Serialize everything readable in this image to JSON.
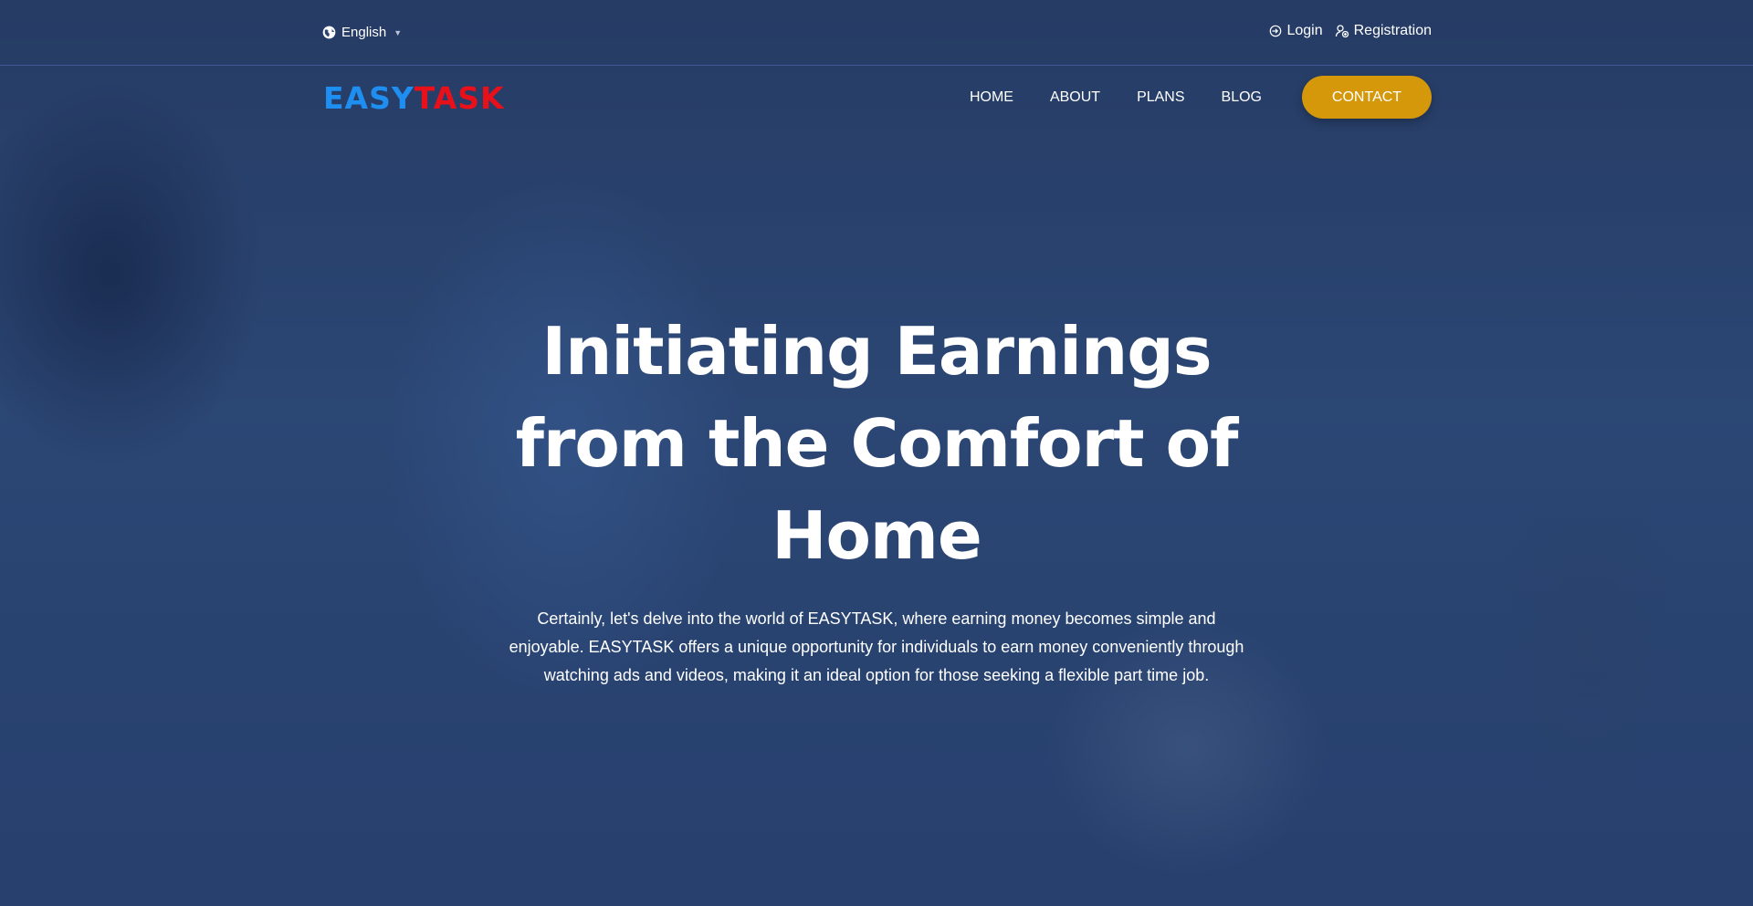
{
  "topbar": {
    "language": "English",
    "login_label": "Login",
    "registration_label": "Registration"
  },
  "brand": {
    "logo_part1": "EASY",
    "logo_part2": "TASK",
    "colors": {
      "easy": "#1e8ef0",
      "task": "#e8101a",
      "accent": "#d4980a"
    }
  },
  "nav": {
    "items": [
      {
        "label": "HOME"
      },
      {
        "label": "ABOUT"
      },
      {
        "label": "PLANS"
      },
      {
        "label": "BLOG"
      }
    ],
    "contact_label": "CONTACT"
  },
  "hero": {
    "headline_lines": [
      "Initiating Earnings",
      "from the Comfort of",
      "Home"
    ],
    "subtext_lines": [
      "Certainly, let's delve into the world of EASYTASK, where earning money becomes simple and",
      "enjoyable. EASYTASK offers a unique opportunity for individuals to earn money conveniently through",
      "watching ads and videos, making it an ideal option for those seeking a flexible part time job."
    ]
  }
}
